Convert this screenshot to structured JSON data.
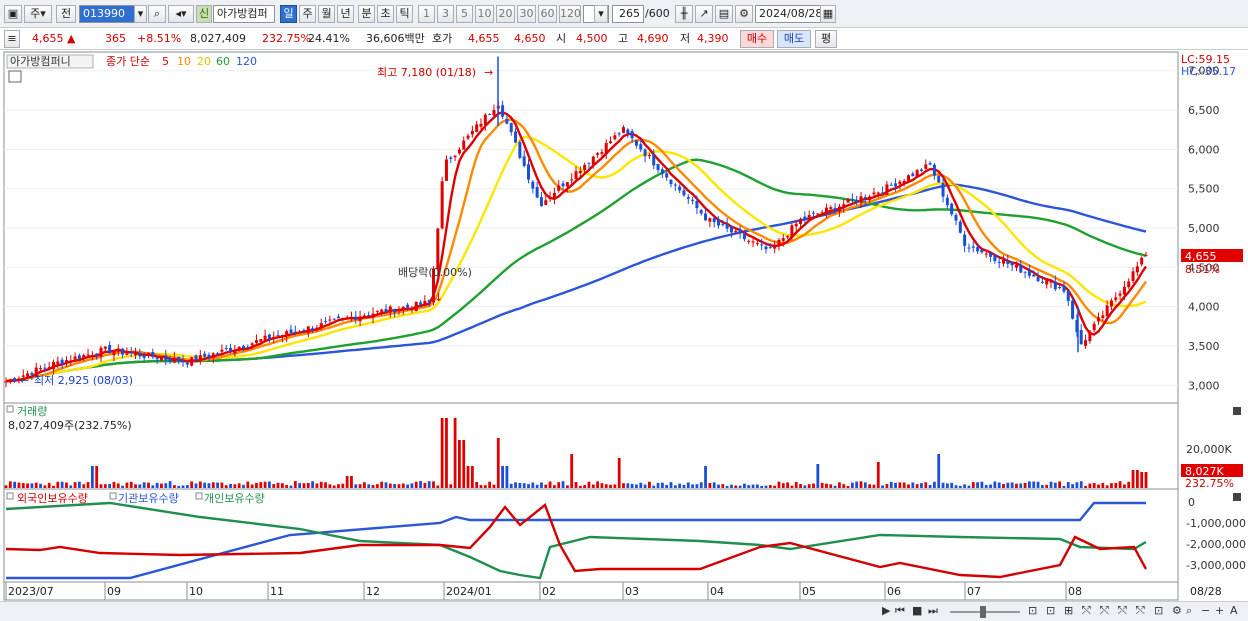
{
  "toolbar": {
    "market": "주",
    "prev_label": "전",
    "code": "013990",
    "new_badge": "신",
    "stock_name": "아가방컴퍼",
    "periods": [
      "일",
      "주",
      "월",
      "년",
      "분",
      "초",
      "틱"
    ],
    "active_period": "일",
    "intervals": [
      "1",
      "3",
      "5",
      "10",
      "20",
      "30",
      "60",
      "120"
    ],
    "count": "265",
    "count_max": "/600",
    "date": "2024/08/28"
  },
  "quote": {
    "price": "4,655",
    "change": "365",
    "change_pct": "+8.51%",
    "volume": "8,027,409",
    "volume_ratio": "232.75%",
    "turnover": "24.41%",
    "amount": "36,606백만",
    "bid_label": "호가",
    "ask_price": "4,655",
    "bid_price": "4,650",
    "open_label": "시",
    "open": "4,500",
    "high_label": "고",
    "high": "4,690",
    "low_label": "저",
    "low": "4,390",
    "buy_label": "매수",
    "sell_label": "매도",
    "eval_label": "평"
  },
  "price_panel": {
    "name_label": "아가방컴퍼니",
    "close_label": "종가 단순",
    "ma_labels": [
      "5",
      "10",
      "20",
      "60",
      "120"
    ],
    "ma_colors": [
      "#e00000",
      "#ff8a00",
      "#ffe500",
      "#1fa02f",
      "#2b56d8"
    ],
    "lc": "LC:59.15",
    "hc": "HC:-35.17",
    "high_annotation": "최고 7,180 (01/18)",
    "low_annotation": "최저 2,925 (08/03)",
    "dividend_annotation": "배당락(0.00%)",
    "y_ticks": [
      "7,000",
      "6,500",
      "6,000",
      "5,500",
      "5,000",
      "4,500",
      "4,000",
      "3,500",
      "3,000"
    ],
    "current_label": "4,655",
    "current_pct": "8.51%"
  },
  "volume_panel": {
    "title": "거래량",
    "value_label": "8,027,409주(232.75%)",
    "y_ticks": [
      "20,000K"
    ],
    "current_label": "8,027K",
    "current_pct": "232.75%"
  },
  "holding_panel": {
    "labels": [
      "외국인보유수량",
      "기관보유수량",
      "개인보유수량"
    ],
    "colors": [
      "#d40000",
      "#2b56d8",
      "#1f8f4f"
    ],
    "y_ticks": [
      "0",
      "-1,000,000",
      "-2,000,000",
      "-3,000,000"
    ]
  },
  "x_labels": [
    "2023/07",
    "09",
    "10",
    "11",
    "12",
    "2024/01",
    "02",
    "03",
    "04",
    "05",
    "06",
    "07",
    "08",
    "08/28"
  ],
  "chart_data": {
    "type": "candlestick",
    "period": "daily",
    "y_range": [
      2800,
      7200
    ],
    "high": {
      "value": 7180,
      "date": "01/18"
    },
    "low": {
      "value": 2925,
      "date": "08/03"
    },
    "approx_close_path": [
      {
        "x": "2023/07",
        "y": 3050
      },
      {
        "x": "08",
        "y": 3300
      },
      {
        "x": "09",
        "y": 3450
      },
      {
        "x": "10",
        "y": 3300
      },
      {
        "x": "11",
        "y": 3600
      },
      {
        "x": "12",
        "y": 3900
      },
      {
        "x": "12/28",
        "y": 4050
      },
      {
        "x": "2024/01",
        "y": 5800
      },
      {
        "x": "01/18",
        "y": 6600
      },
      {
        "x": "02",
        "y": 5300
      },
      {
        "x": "03",
        "y": 6250
      },
      {
        "x": "04",
        "y": 5100
      },
      {
        "x": "04/20",
        "y": 4700
      },
      {
        "x": "05",
        "y": 5100
      },
      {
        "x": "06",
        "y": 5500
      },
      {
        "x": "06/10",
        "y": 5800
      },
      {
        "x": "07",
        "y": 4800
      },
      {
        "x": "08",
        "y": 4200
      },
      {
        "x": "08/05",
        "y": 3500
      },
      {
        "x": "08/28",
        "y": 4655
      }
    ]
  }
}
